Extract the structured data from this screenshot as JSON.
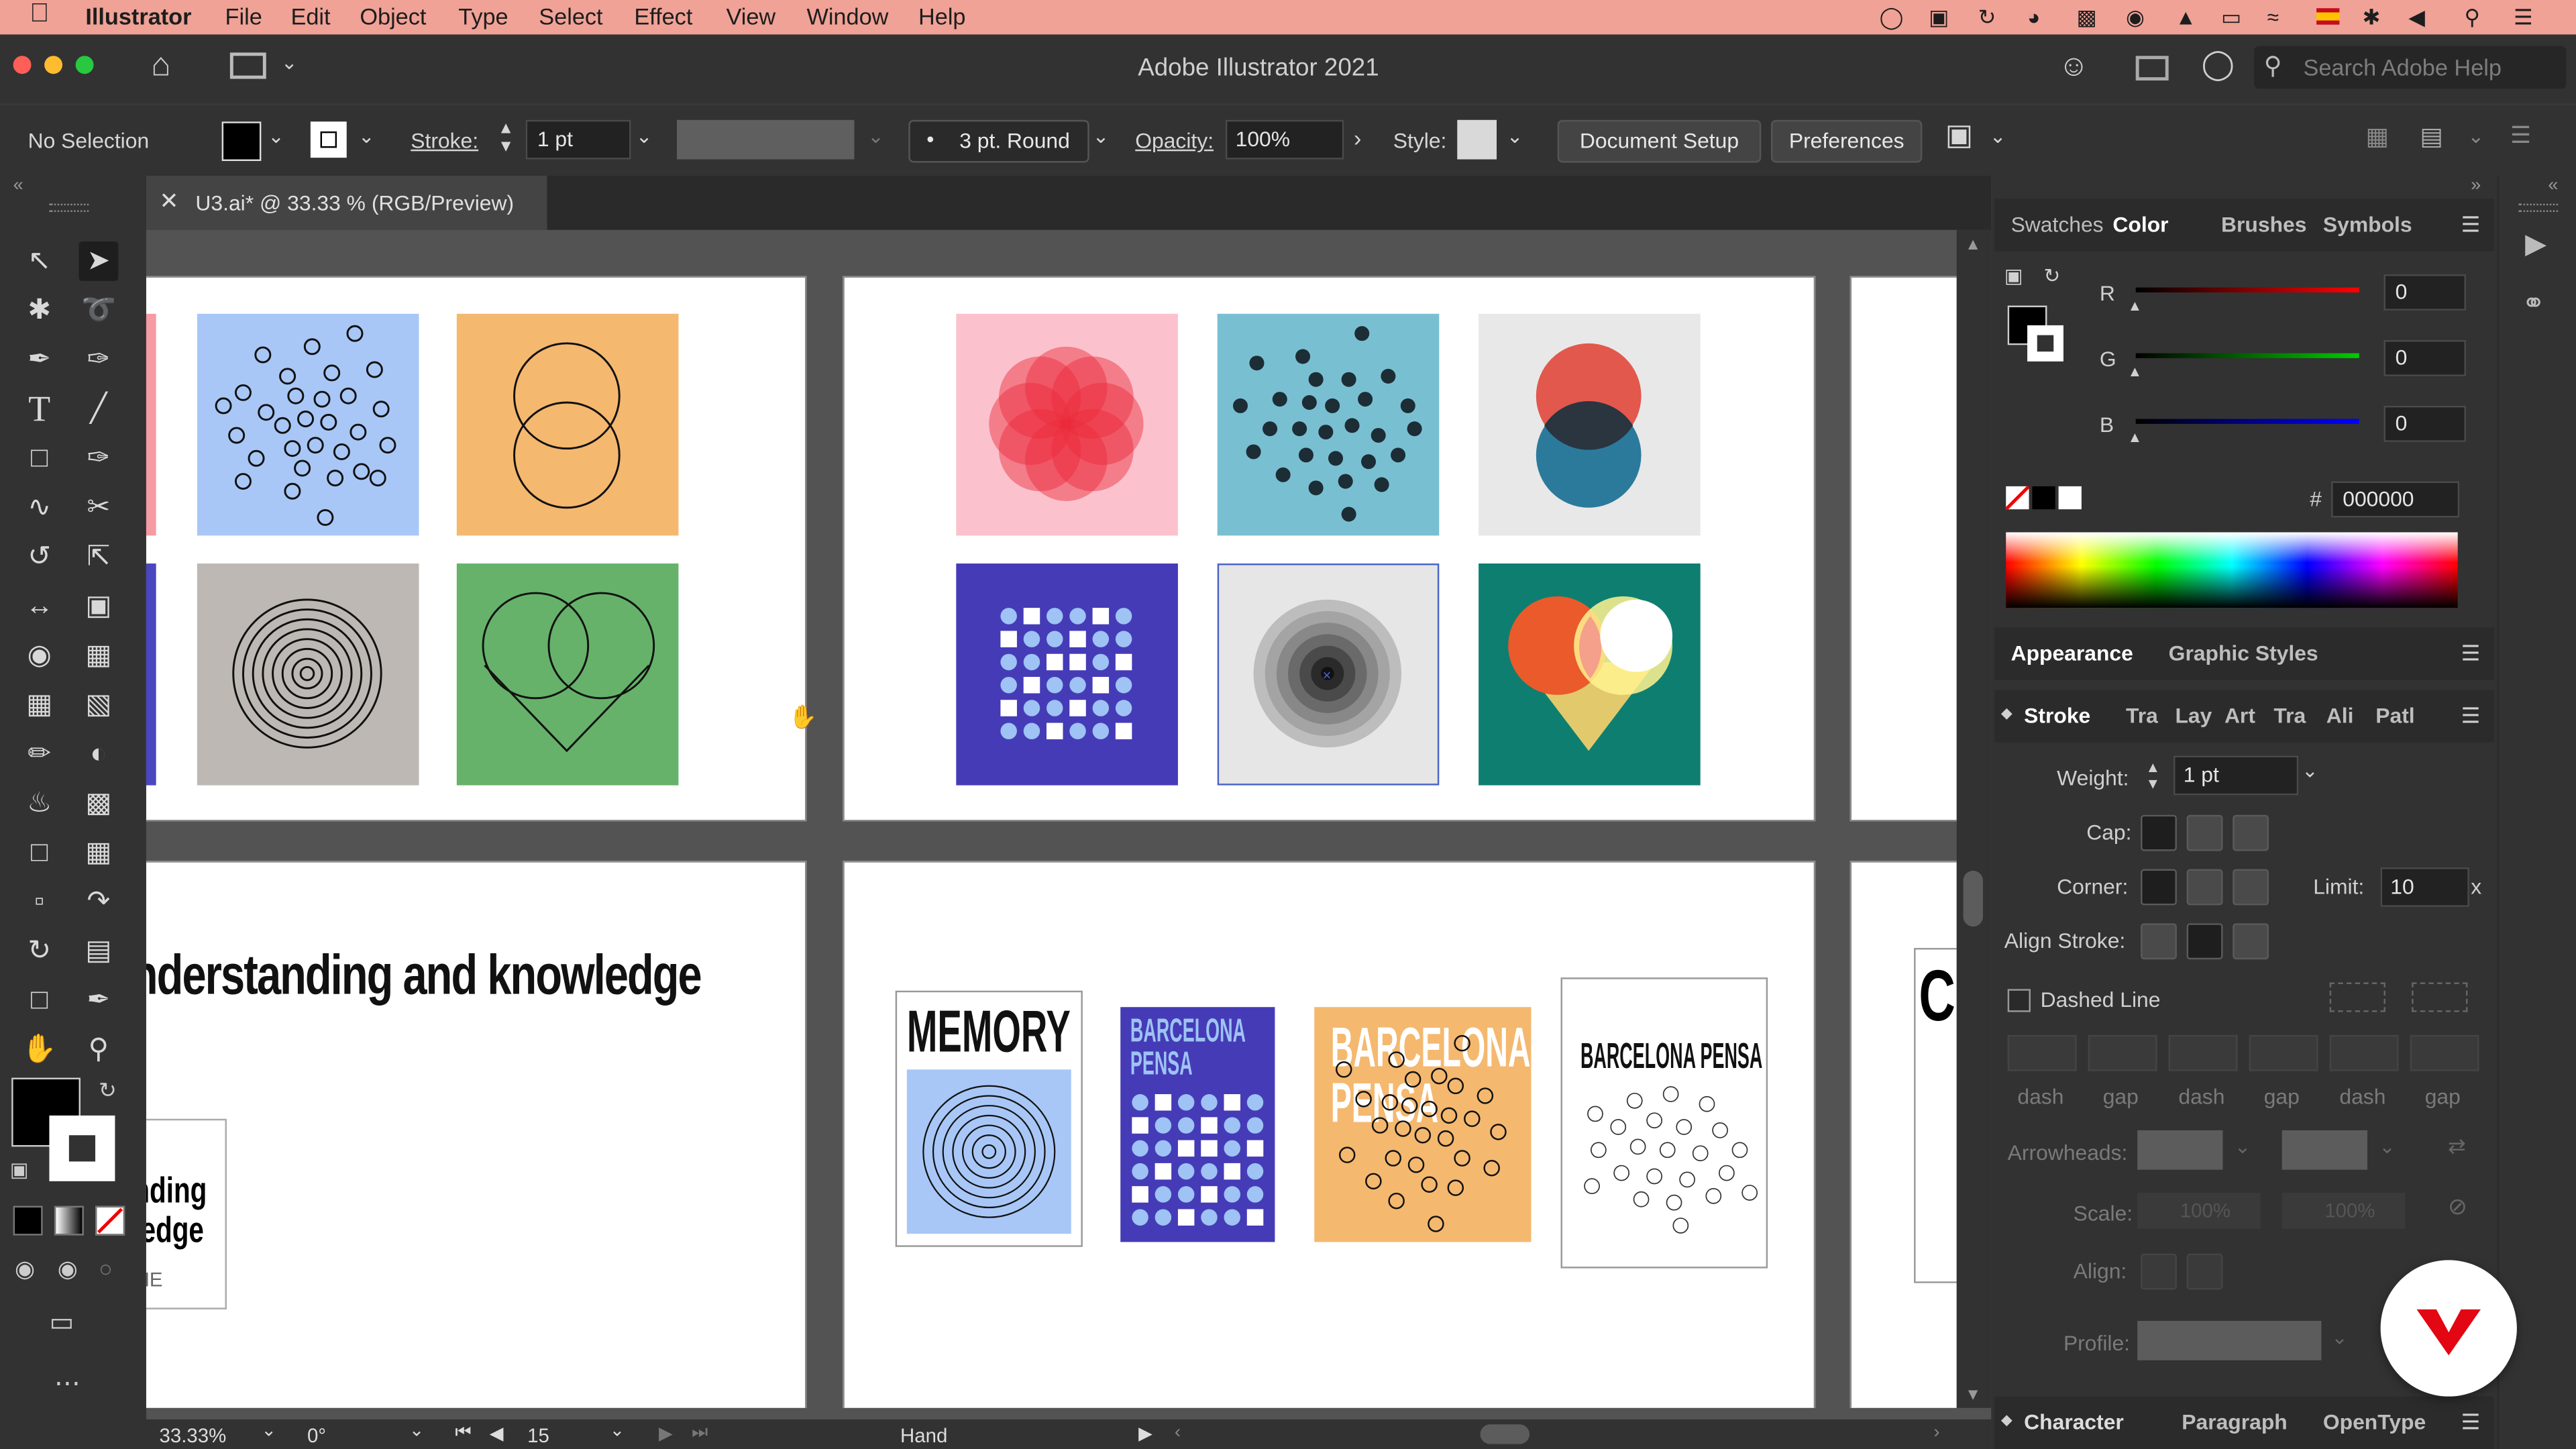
{
  "menubar": {
    "app_name": "Illustrator",
    "items": [
      "File",
      "Edit",
      "Object",
      "Type",
      "Select",
      "Effect",
      "View",
      "Window",
      "Help"
    ]
  },
  "titlebar": {
    "title": "Adobe Illustrator 2021",
    "search_placeholder": "Search Adobe Help"
  },
  "control_bar": {
    "selection": "No Selection",
    "stroke_label": "Stroke:",
    "stroke_value": "1 pt",
    "brush_value": "3 pt. Round",
    "opacity_label": "Opacity:",
    "opacity_value": "100%",
    "style_label": "Style:",
    "document_setup": "Document Setup",
    "preferences": "Preferences"
  },
  "document": {
    "tab_title": "U3.ai* @ 33.33 % (RGB/Preview)"
  },
  "canvas": {
    "headline": "nderstanding and knowledge",
    "small_card_line1": "nding",
    "small_card_line2": "ledge",
    "small_card_line3": "ME",
    "poster1_title": "MEMORY",
    "poster2_title_1": "BARCELONA",
    "poster2_title_2": "PENSA",
    "poster3_title_1": "BARCELONA",
    "poster3_title_2": "PENSA",
    "poster4_title": "BARCELONA PENSA",
    "partial_letter": "C"
  },
  "status_bar": {
    "zoom": "33.33%",
    "rotation": "0°",
    "artboard": "15",
    "tool": "Hand"
  },
  "color_panel": {
    "tabs": [
      "Swatches",
      "Color",
      "Brushes",
      "Symbols"
    ],
    "active_tab": "Color",
    "r_label": "R",
    "r_value": "0",
    "g_label": "G",
    "g_value": "0",
    "b_label": "B",
    "b_value": "0",
    "hash": "#",
    "hex": "000000"
  },
  "appearance_panel": {
    "tabs": [
      "Appearance",
      "Graphic Styles"
    ]
  },
  "stroke_panel": {
    "tabs": [
      "Stroke",
      "Tra",
      "Lay",
      "Art",
      "Tra",
      "Ali",
      "Patl"
    ],
    "weight_label": "Weight:",
    "weight_value": "1 pt",
    "cap_label": "Cap:",
    "corner_label": "Corner:",
    "limit_label": "Limit:",
    "limit_value": "10",
    "limit_unit": "x",
    "align_label": "Align Stroke:",
    "dashed_label": "Dashed Line",
    "dash_labels": [
      "dash",
      "gap",
      "dash",
      "gap",
      "dash",
      "gap"
    ],
    "arrowheads_label": "Arrowheads:",
    "scale_label": "Scale:",
    "scale_1": "100%",
    "scale_2": "100%",
    "align2_label": "Align:",
    "profile_label": "Profile:"
  },
  "character_panel": {
    "tabs": [
      "Character",
      "Paragraph",
      "OpenType"
    ]
  },
  "colors": {
    "menubar_bg": "#f0a296",
    "panel_bg": "#323232",
    "canvas_bg": "#535353",
    "accent": "#e30613"
  }
}
